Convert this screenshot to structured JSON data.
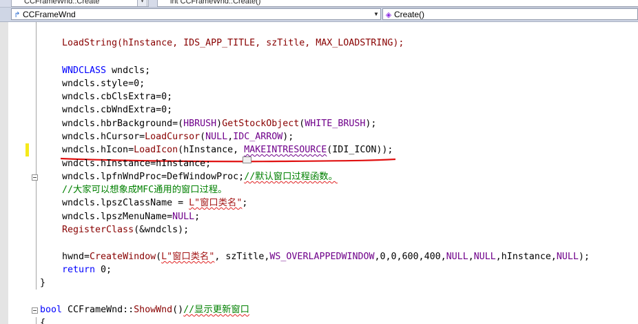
{
  "top_bar": {
    "left_label": "CCFrameWnd::Create",
    "right_label": "int CCFrameWnd::Create()"
  },
  "nav": {
    "class_combo": "CCFrameWnd",
    "member_combo": "Create()"
  },
  "code": {
    "l1": "LoadString(hInstance, IDS_APP_TITLE, szTitle, MAX_LOADSTRING);",
    "l2_kw": "WNDCLASS",
    "l2_rest": " wndcls;",
    "l3": "wndcls.style=0;",
    "l4": "wndcls.cbClsExtra=0;",
    "l5": "wndcls.cbWndExtra=0;",
    "l6a": "wndcls.hbrBackground=(",
    "l6b": "HBRUSH",
    "l6c": ")",
    "l6d": "GetStockObject",
    "l6e": "(",
    "l6f": "WHITE_BRUSH",
    "l6g": ");",
    "l7a": "wndcls.hCursor=",
    "l7b": "LoadCursor",
    "l7c": "(",
    "l7d": "NULL",
    "l7e": ",",
    "l7f": "IDC_ARROW",
    "l7g": ");",
    "l8a": "wndcls.hIcon=",
    "l8b": "LoadIcon",
    "l8c": "(hInstance, ",
    "l8d": "MAKEINTRESOURCE",
    "l8e": "(IDI_ICON));",
    "l9": "wndcls.hInstance=hInstance;",
    "l10a": "wndcls.lpfnWndProc=DefWindowProc;",
    "l10b": "//默认窗口过程函数。",
    "l11": "//大家可以想象成MFC通用的窗口过程。",
    "l12a": "wndcls.lpszClassName = ",
    "l12b": "L\"窗口类名\"",
    "l12c": ";",
    "l13a": "wndcls.lpszMenuName=",
    "l13b": "NULL",
    "l13c": ";",
    "l14a": "RegisterClass",
    "l14b": "(&wndcls);",
    "l15a": "hwnd=",
    "l15b": "CreateWindow",
    "l15c": "(",
    "l15d": "L\"窗口类名\"",
    "l15e": ", szTitle,",
    "l15f": "WS_OVERLAPPEDWINDOW",
    "l15g": ",0,0,600,400,",
    "l15h": "NULL",
    "l15i": ",",
    "l15j": "NULL",
    "l15k": ",hInstance,",
    "l15l": "NULL",
    "l15m": ");",
    "l16a": "return",
    "l16b": " 0;",
    "l17": "}",
    "l18a": "bool",
    "l18b": " CCFrameWnd::",
    "l18c": "ShowWnd",
    "l18d": "()",
    "l18e": "//显示更新窗口",
    "l19": "{"
  },
  "colors": {
    "keyword": "#0000ff",
    "function": "#880000",
    "macro": "#6f008a",
    "comment": "#008000",
    "string": "#a31515",
    "annotation": "#e01010",
    "change_bar": "#f5e91a"
  }
}
